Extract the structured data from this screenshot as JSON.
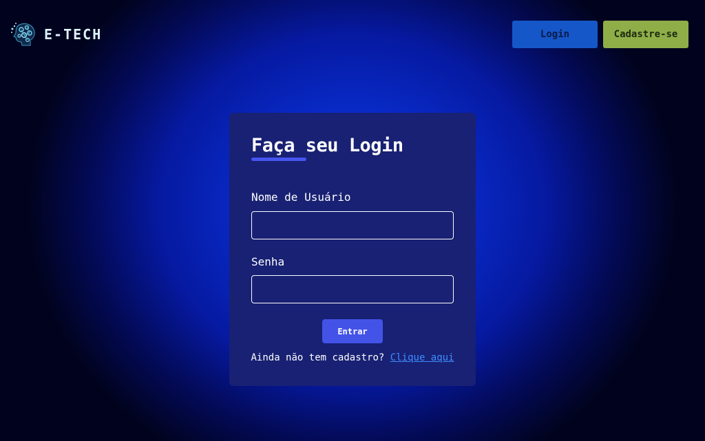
{
  "brand": {
    "name": "E-TECH",
    "logo_icon": "ai-head-circuit-icon"
  },
  "nav": {
    "login_label": "Login",
    "signup_label": "Cadastre-se"
  },
  "form": {
    "title": "Faça seu Login",
    "username_label": "Nome de Usuário",
    "username_value": "",
    "password_label": "Senha",
    "password_value": "",
    "submit_label": "Entrar",
    "signup_prompt": "Ainda não tem cadastro?",
    "signup_link": "Clique aqui"
  },
  "colors": {
    "background_center": "#0a32d8",
    "background_edge": "#01031e",
    "card": "#182173",
    "accent": "#4655f0",
    "login_button": "#1557c8",
    "signup_button": "#8fae48",
    "link": "#3f8dff"
  }
}
